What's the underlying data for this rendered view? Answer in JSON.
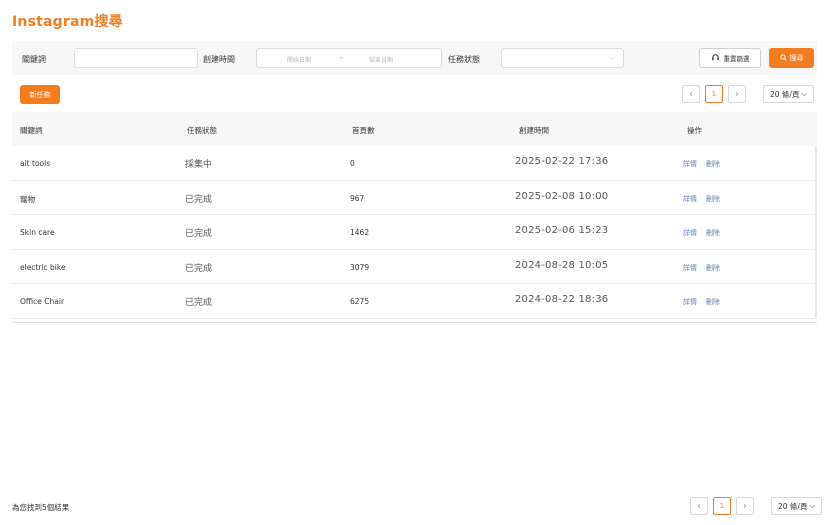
{
  "page": {
    "title": "Instagram搜尋"
  },
  "filters": {
    "keyword_label": "關鍵詞",
    "keyword_value": "",
    "created_label": "創建時間",
    "start_placeholder": "開始日期",
    "date_separator": "-",
    "end_placeholder": "結束日期",
    "status_label": "任務狀態",
    "status_value": "",
    "reset_label": "重置篩選",
    "search_label": "搜尋"
  },
  "toolbar": {
    "new_task_label": "新任務"
  },
  "pagination": {
    "current_page": "1",
    "page_size": "20 條/頁",
    "prev_glyph": "‹",
    "next_glyph": "›"
  },
  "table": {
    "columns": [
      "關鍵詞",
      "任務狀態",
      "首頁數",
      "創建時間",
      "操作"
    ],
    "rows": [
      {
        "keyword": "ait tools",
        "status": "採集中",
        "count": "0",
        "created": "2025-02-22 17:36",
        "detail": "詳情",
        "delete": "刪除"
      },
      {
        "keyword": "寵物",
        "status": "已完成",
        "count": "967",
        "created": "2025-02-08 10:00",
        "detail": "詳情",
        "delete": "刪除"
      },
      {
        "keyword": "Skin care",
        "status": "已完成",
        "count": "1462",
        "created": "2025-02-06 15:23",
        "detail": "詳情",
        "delete": "刪除"
      },
      {
        "keyword": "electric bike",
        "status": "已完成",
        "count": "3079",
        "created": "2024-08-28 10:05",
        "detail": "詳情",
        "delete": "刪除"
      },
      {
        "keyword": "Office Chair",
        "status": "已完成",
        "count": "6275",
        "created": "2024-08-22 18:36",
        "detail": "詳情",
        "delete": "刪除"
      }
    ]
  },
  "footer": {
    "result_text": "為您找到5個結果"
  },
  "colors": {
    "accent": "#f47c20",
    "link": "#5b7fb0"
  },
  "icons": {
    "reset": "headset-icon",
    "search": "search-icon",
    "dropdown": "chevron-down-icon"
  }
}
